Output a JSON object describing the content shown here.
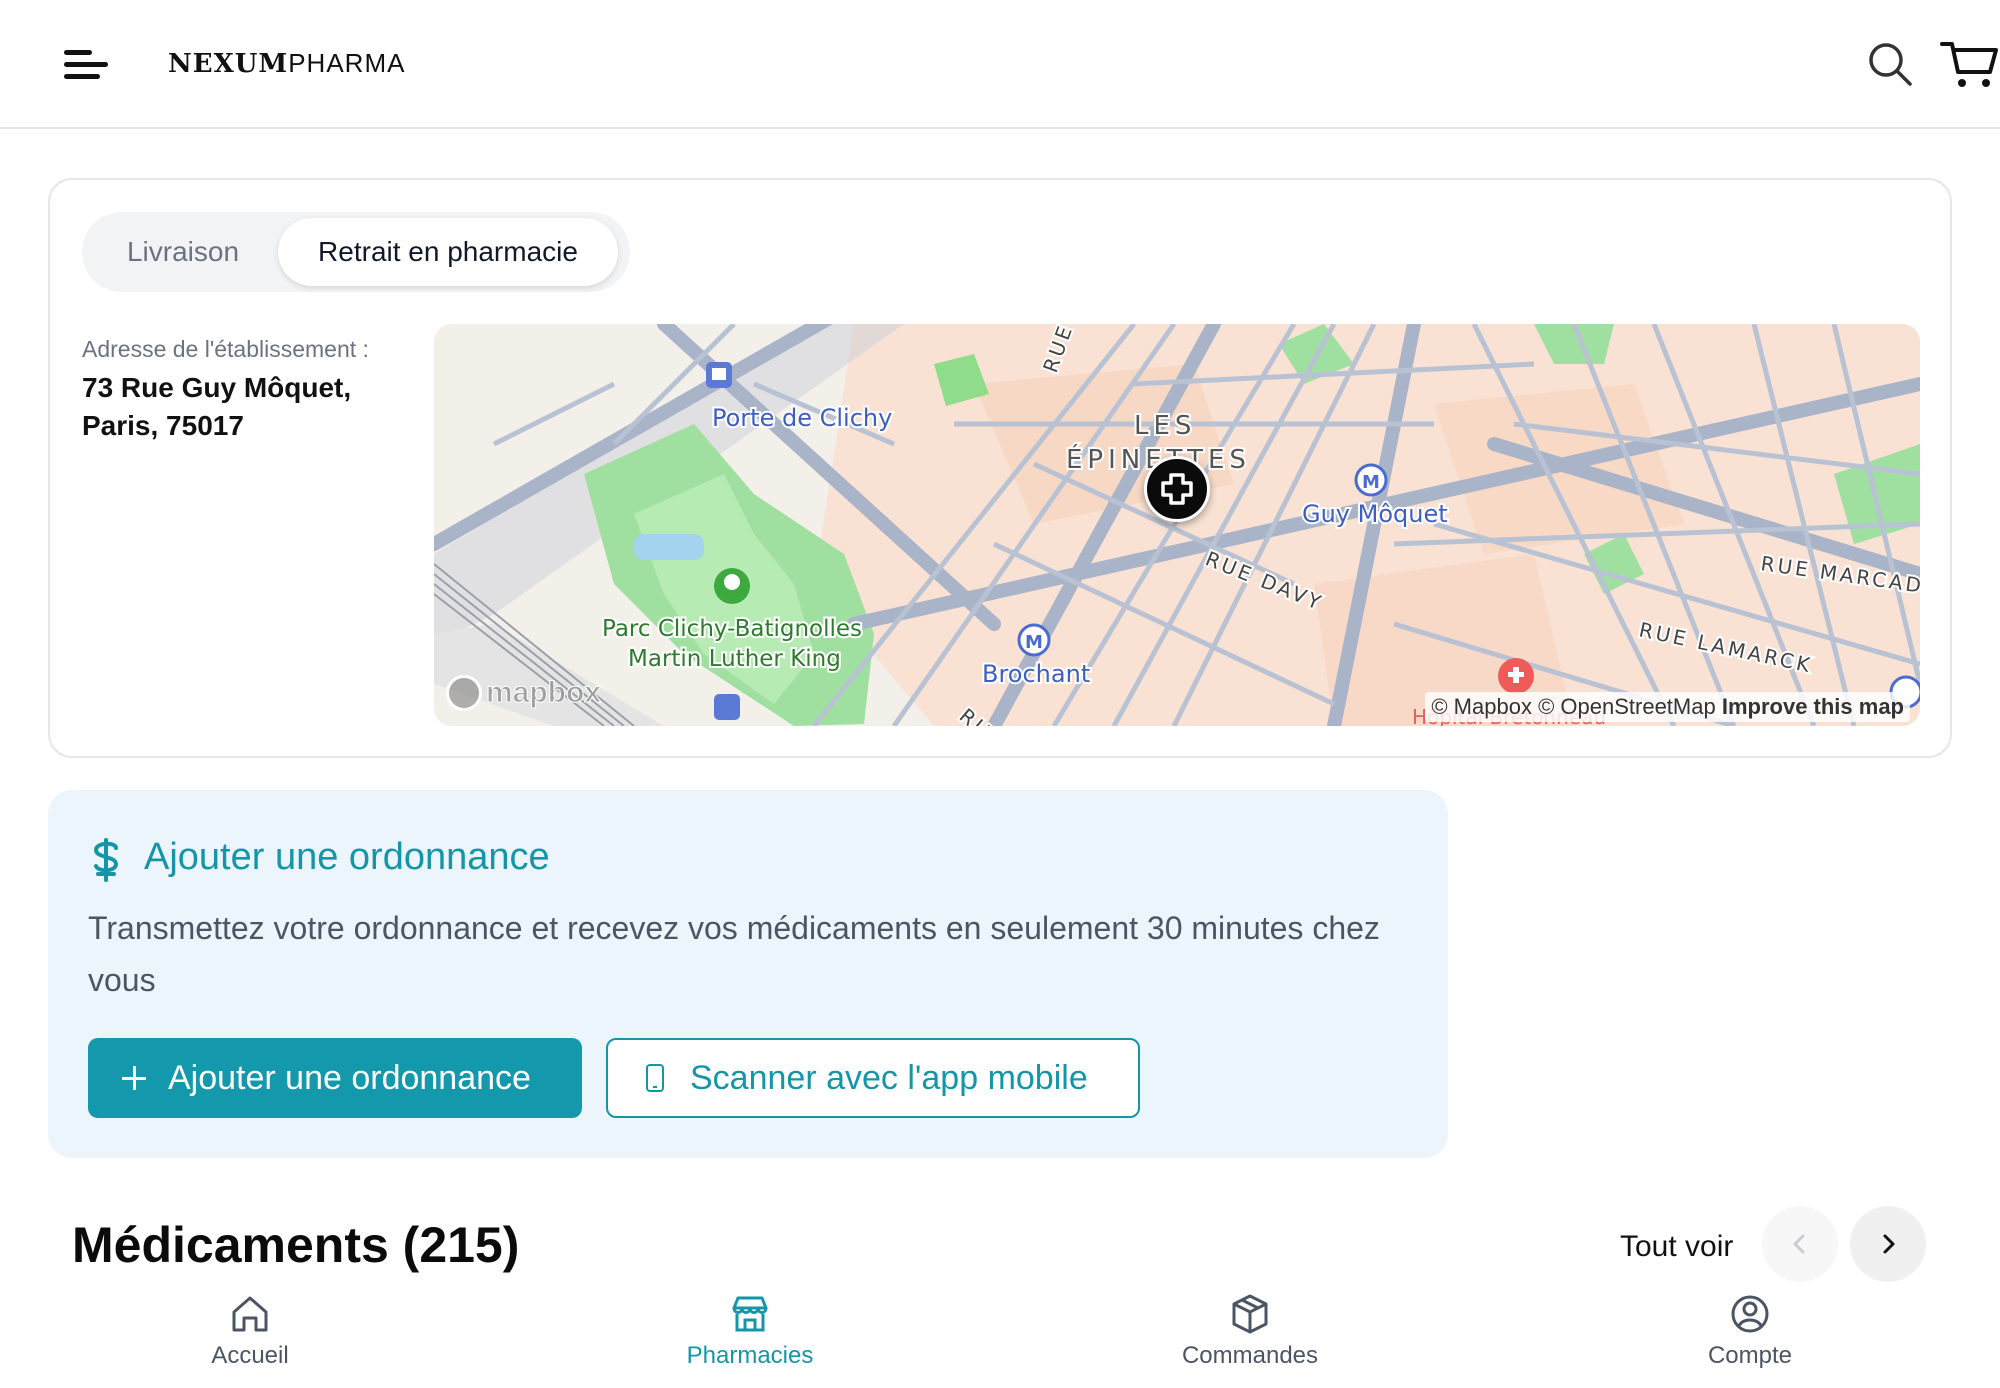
{
  "header": {
    "brand_bold": "NEXUM",
    "brand_light": "PHARMA",
    "menu_icon": "menu-icon",
    "search_icon": "search-icon",
    "cart_icon": "cart-icon"
  },
  "delivery": {
    "tabs": [
      {
        "label": "Livraison",
        "active": false
      },
      {
        "label": "Retrait en pharmacie",
        "active": true
      }
    ],
    "address_label": "Adresse de l'établissement :",
    "address_line1": "73 Rue Guy Môquet,",
    "address_line2": "Paris, 75017"
  },
  "map": {
    "labels": {
      "porte_de_clichy": "Porte de Clichy",
      "les": "LES",
      "epinettes": "ÉPINETTES",
      "guy_moquet": "Guy Môquet",
      "parc_line1": "Parc Clichy-Batignolles",
      "parc_line2": "Martin Luther King",
      "brochant": "Brochant",
      "rue_davy": "RUE DAVY",
      "rue_marcadet": "RUE MARCAD",
      "rue_lamarck": "RUE LAMARCK",
      "rue_top": "RUE",
      "rue_bottom": "RU",
      "hopital": "Hôpital Bretonneau"
    },
    "logo_text": "mapbox",
    "attribution": {
      "mapbox": "© Mapbox",
      "osm": "© OpenStreetMap",
      "improve": "Improve this map"
    },
    "pin_icon": "pharmacy-cross-icon"
  },
  "prescription": {
    "title": "Ajouter une ordonnance",
    "description": "Transmettez votre ordonnance et recevez vos médicaments en seulement 30 minutes chez vous",
    "add_button": "Ajouter une ordonnance",
    "scan_button": "Scanner avec l'app mobile",
    "accent_color": "#1596a8"
  },
  "medications": {
    "title": "Médicaments (215)",
    "see_all": "Tout voir"
  },
  "bottom_nav": [
    {
      "label": "Accueil",
      "icon": "home-icon",
      "active": false
    },
    {
      "label": "Pharmacies",
      "icon": "store-icon",
      "active": true
    },
    {
      "label": "Commandes",
      "icon": "package-icon",
      "active": false
    },
    {
      "label": "Compte",
      "icon": "user-circle-icon",
      "active": false
    }
  ]
}
